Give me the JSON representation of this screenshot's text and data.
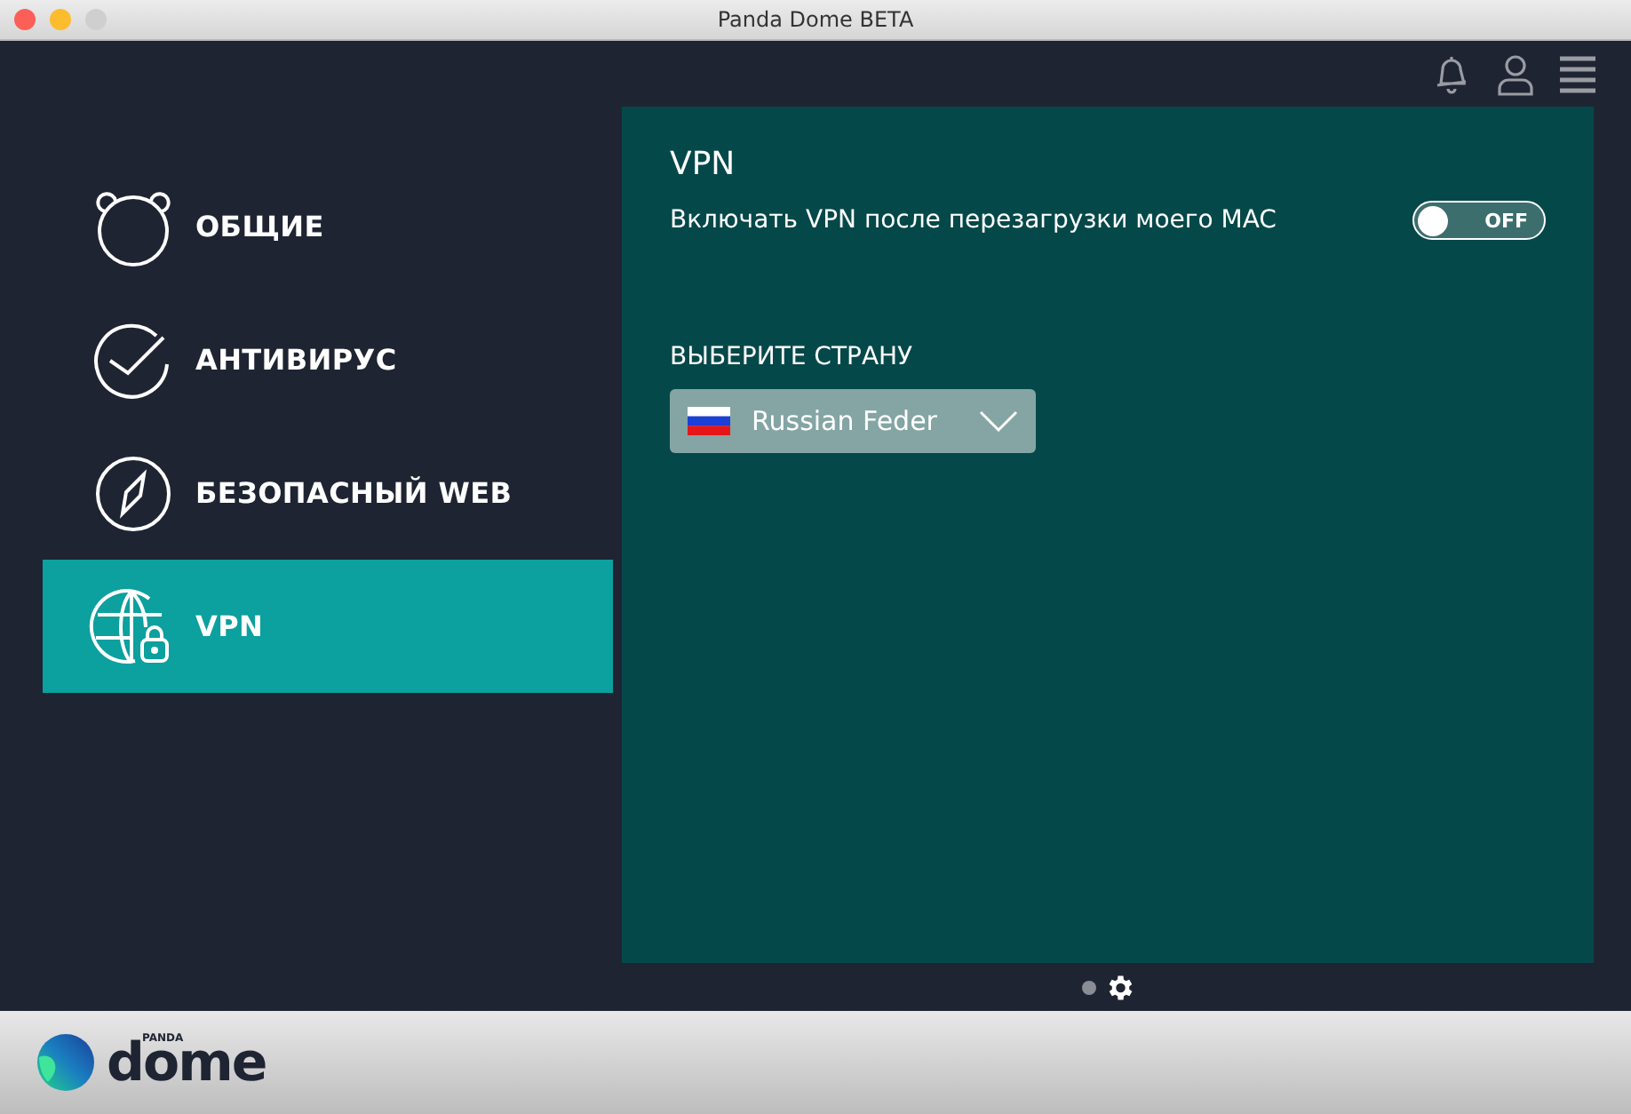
{
  "window": {
    "title": "Panda Dome BETA"
  },
  "sidebar": {
    "items": [
      {
        "label": "ОБЩИЕ",
        "kind": "bear",
        "selected": false
      },
      {
        "label": "АНТИВИРУС",
        "kind": "check",
        "selected": false
      },
      {
        "label": "БЕЗОПАСНЫЙ WEB",
        "kind": "compass",
        "selected": false
      },
      {
        "label": "VPN",
        "kind": "globe",
        "selected": true
      }
    ]
  },
  "panel": {
    "title": "VPN",
    "setting": {
      "label": "Включать VPN после перезагрузки моего MAC",
      "on": false,
      "state_text": "OFF"
    },
    "country_label": "ВЫБЕРИТЕ СТРАНУ",
    "country": {
      "value": "Russian Feder"
    }
  },
  "pager": [
    {
      "kind": "dot",
      "selected": false
    },
    {
      "kind": "gear",
      "selected": true
    }
  ],
  "logo": {
    "small": "PANDA",
    "big": "dome"
  }
}
